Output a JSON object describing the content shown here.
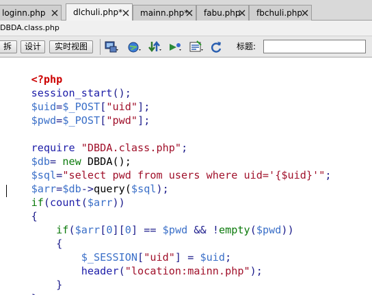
{
  "tabs": [
    {
      "label": "loginn.php",
      "active": false
    },
    {
      "label": "dlchuli.php*",
      "active": true
    },
    {
      "label": "mainn.php*",
      "active": false
    },
    {
      "label": "fabu.php",
      "active": false
    },
    {
      "label": "fbchuli.php",
      "active": false
    }
  ],
  "path_bar": {
    "text": "DBDA.class.php"
  },
  "toolbar": {
    "split_label": "拆分",
    "design_label": "设计",
    "live_view_label": "实时视图",
    "title_label": "标题:",
    "title_value": "",
    "icons": [
      "multiscreen-icon",
      "browser-preview-icon",
      "file-transfer-icon",
      "validate-icon",
      "visual-aids-icon",
      "refresh-icon"
    ]
  },
  "code": {
    "line1": [
      "<?php"
    ],
    "line2": [
      "session_start",
      "();"
    ],
    "line3": [
      "$uid",
      "=",
      "$_POST",
      "[",
      "\"uid\"",
      "];"
    ],
    "line4": [
      "$pwd",
      "=",
      "$_POST",
      "[",
      "\"pwd\"",
      "];"
    ],
    "line6": [
      "require",
      " ",
      "\"DBDA.class.php\"",
      ";"
    ],
    "line7": [
      "$db",
      "= ",
      "new",
      " DBDA();"
    ],
    "line8": [
      "$sql",
      "=",
      "\"select pwd from users where uid='{$uid}'\"",
      ";"
    ],
    "line9": [
      "$arr",
      "=",
      "$db",
      "->",
      "query(",
      "$sql",
      ");"
    ],
    "line10": [
      "if",
      "(",
      "count",
      "(",
      "$arr",
      "))"
    ],
    "line11": [
      "{"
    ],
    "line12": [
      "    ",
      "if",
      "(",
      "$arr",
      "[",
      "0",
      "][",
      "0",
      "] == ",
      "$pwd",
      " && !",
      "empty",
      "(",
      "$pwd",
      "))"
    ],
    "line13": [
      "    ",
      "{"
    ],
    "line14": [
      "        ",
      "$_SESSION",
      "[",
      "\"uid\"",
      "] = ",
      "$uid",
      ";"
    ],
    "line15": [
      "        ",
      "header",
      "(",
      "\"location:mainn.php\"",
      ");"
    ],
    "line16": [
      "    ",
      "}"
    ],
    "line17": [
      "}"
    ]
  }
}
